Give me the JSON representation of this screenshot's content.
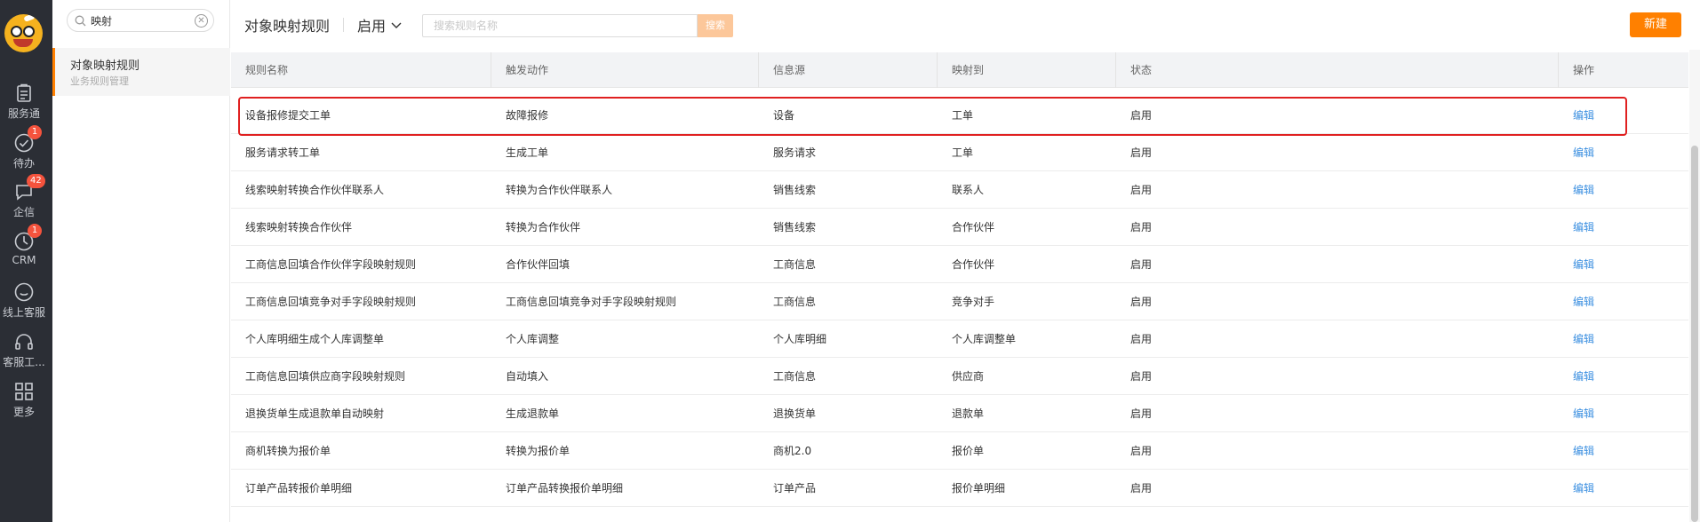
{
  "rail": {
    "items": [
      {
        "label": "服务通",
        "icon": "clipboard-icon"
      },
      {
        "label": "待办",
        "icon": "check-circle-icon",
        "badge": "1"
      },
      {
        "label": "企信",
        "icon": "chat-bubble-icon",
        "badge": "42"
      },
      {
        "label": "CRM",
        "icon": "clock-icon",
        "badge": "1"
      },
      {
        "label": "线上客服",
        "icon": "smile-icon"
      },
      {
        "label": "客服工...",
        "icon": "headset-icon"
      },
      {
        "label": "更多",
        "icon": "grid-icon"
      }
    ]
  },
  "nav": {
    "search_value": "映射",
    "items": [
      {
        "title": "对象映射规则",
        "subtitle": "业务规则管理"
      }
    ]
  },
  "header": {
    "title": "对象映射规则",
    "status_filter": "启用",
    "search_placeholder": "搜索规则名称",
    "search_button": "搜索",
    "new_button": "新建"
  },
  "table": {
    "columns": [
      "规则名称",
      "触发动作",
      "信息源",
      "映射到",
      "状态",
      "操作"
    ],
    "rows": [
      {
        "name": "设备报修提交工单",
        "trigger": "故障报修",
        "source": "设备",
        "target": "工单",
        "status": "启用",
        "action": "编辑"
      },
      {
        "name": "服务请求转工单",
        "trigger": "生成工单",
        "source": "服务请求",
        "target": "工单",
        "status": "启用",
        "action": "编辑"
      },
      {
        "name": "线索映射转换合作伙伴联系人",
        "trigger": "转换为合作伙伴联系人",
        "source": "销售线索",
        "target": "联系人",
        "status": "启用",
        "action": "编辑"
      },
      {
        "name": "线索映射转换合作伙伴",
        "trigger": "转换为合作伙伴",
        "source": "销售线索",
        "target": "合作伙伴",
        "status": "启用",
        "action": "编辑"
      },
      {
        "name": "工商信息回填合作伙伴字段映射规则",
        "trigger": "合作伙伴回填",
        "source": "工商信息",
        "target": "合作伙伴",
        "status": "启用",
        "action": "编辑"
      },
      {
        "name": "工商信息回填竞争对手字段映射规则",
        "trigger": "工商信息回填竞争对手字段映射规则",
        "source": "工商信息",
        "target": "竞争对手",
        "status": "启用",
        "action": "编辑"
      },
      {
        "name": "个人库明细生成个人库调整单",
        "trigger": "个人库调整",
        "source": "个人库明细",
        "target": "个人库调整单",
        "status": "启用",
        "action": "编辑"
      },
      {
        "name": "工商信息回填供应商字段映射规则",
        "trigger": "自动填入",
        "source": "工商信息",
        "target": "供应商",
        "status": "启用",
        "action": "编辑"
      },
      {
        "name": "退换货单生成退款单自动映射",
        "trigger": "生成退款单",
        "source": "退换货单",
        "target": "退款单",
        "status": "启用",
        "action": "编辑"
      },
      {
        "name": "商机转换为报价单",
        "trigger": "转换为报价单",
        "source": "商机2.0",
        "target": "报价单",
        "status": "启用",
        "action": "编辑"
      },
      {
        "name": "订单产品转报价单明细",
        "trigger": "订单产品转换报价单明细",
        "source": "订单产品",
        "target": "报价单明细",
        "status": "启用",
        "action": "编辑"
      }
    ]
  },
  "colors": {
    "accent": "#ff8000",
    "link": "#3b8fe0",
    "highlight": "#e02020",
    "rail_bg": "#2b2e35"
  }
}
